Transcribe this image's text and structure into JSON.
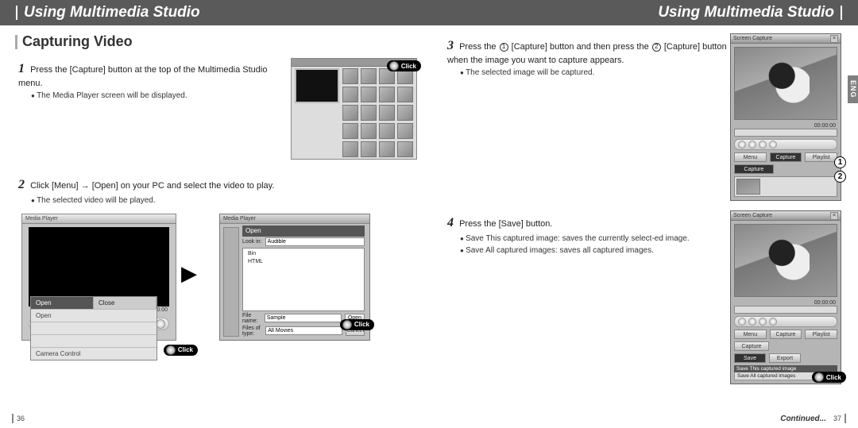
{
  "header": {
    "title": "Using Multimedia Studio"
  },
  "section": {
    "title": "Capturing Video"
  },
  "language_tab": "ENG",
  "continued": "Continued...",
  "left": {
    "page_number": "36",
    "step1": {
      "num": "1",
      "text": "Press the [Capture] button at the top of the Multimedia Studio menu.",
      "bullet": "The Media Player screen will be displayed."
    },
    "step2": {
      "num": "2",
      "text": "Click [Menu] → [Open] on your PC and select the video to play.",
      "bullet": "The selected video will be played."
    },
    "mediaplayer": {
      "title": "Media Player",
      "timecode": "00:00:00",
      "menu": {
        "open": "Open",
        "close": "Close",
        "camera_control": "Camera Control"
      }
    },
    "open_dialog": {
      "title": "Open",
      "lookin_label": "Look in:",
      "lookin_value": "Audible",
      "files": [
        "Bin",
        "HTML"
      ],
      "filename_label": "File name:",
      "filename_value": "Sample",
      "filetype_label": "Files of type:",
      "filetype_value": "All Movies",
      "open_btn": "Open",
      "cancel_btn": "Cancel"
    },
    "click_label": "Click"
  },
  "right": {
    "page_number": "37",
    "step3": {
      "num": "3",
      "text_a": "Press the ",
      "text_b": " [Capture] button and then press the ",
      "text_c": " [Capture] button when the image you want to capture appears.",
      "bullet": "The selected image will be captured."
    },
    "step4": {
      "num": "4",
      "text": "Press the [Save] button.",
      "bullet1": "Save This captured image: saves the currently select-ed image.",
      "bullet2": "Save All captured images: saves all captured images."
    },
    "markers": {
      "m1": "1",
      "m2": "2"
    },
    "screencap": {
      "title": "Screen Capture",
      "timecode": "00:00:00",
      "menu_btn": "Menu",
      "capture_btn": "Capture",
      "playlist_btn": "Playlist",
      "capture2_btn": "Capture",
      "save_btn": "Save",
      "export_btn": "Export",
      "save_this": "Save This captured image",
      "save_all": "Save All captured images"
    },
    "click_label": "Click"
  }
}
